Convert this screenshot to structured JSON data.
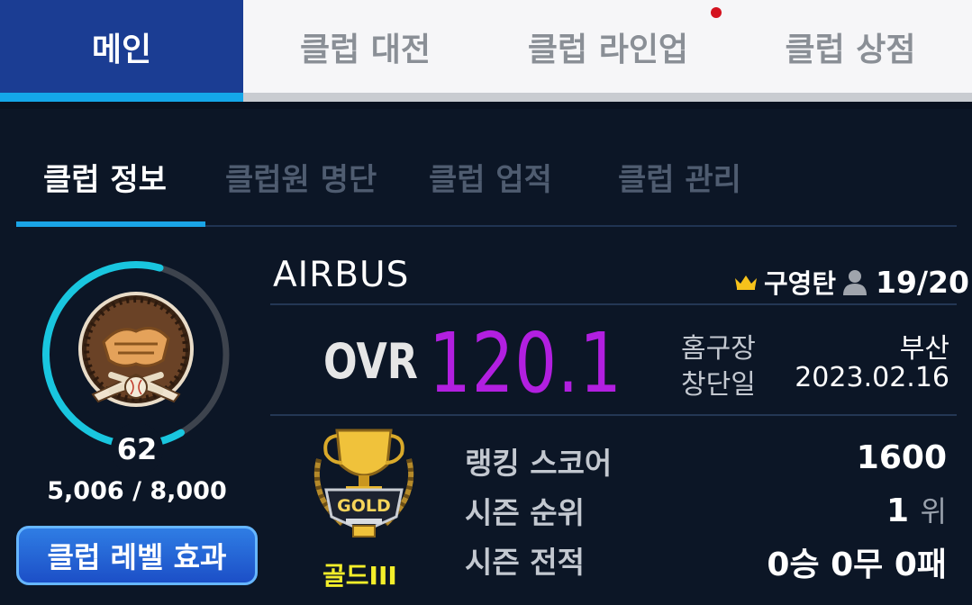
{
  "top_tabs": [
    {
      "label": "메인",
      "active": true
    },
    {
      "label": "클럽 대전"
    },
    {
      "label": "클럽 라인업",
      "notification": true
    },
    {
      "label": "클럽 상점"
    }
  ],
  "sub_tabs": [
    "클럽 정보",
    "클럽원 명단",
    "클럽 업적",
    "클럽 관리"
  ],
  "club": {
    "level": "62",
    "exp": "5,006 / 8,000",
    "exp_progress": 0.6258,
    "level_button": "클럽 레벨 효과",
    "name": "AIRBUS",
    "owner": "구영탄",
    "members": "19/20",
    "ovr_label": "OVR",
    "ovr_value": "120.1",
    "home_label": "홈구장",
    "home_value": "부산",
    "founded_label": "창단일",
    "founded_value": "2023.02.16",
    "tier": "골드III",
    "trophy_text": "GOLD",
    "ranking_score_label": "랭킹 스코어",
    "ranking_score_value": "1600",
    "season_rank_label": "시즌 순위",
    "season_rank_value": "1",
    "season_rank_unit": "위",
    "season_record_label": "시즌 전적",
    "season_record_value": "0승 0무 0패"
  },
  "colors": {
    "accent": "#1aa4e6",
    "ovr": "#b21fe0",
    "tier": "#f3ee2a",
    "ring": "#19c6df"
  }
}
